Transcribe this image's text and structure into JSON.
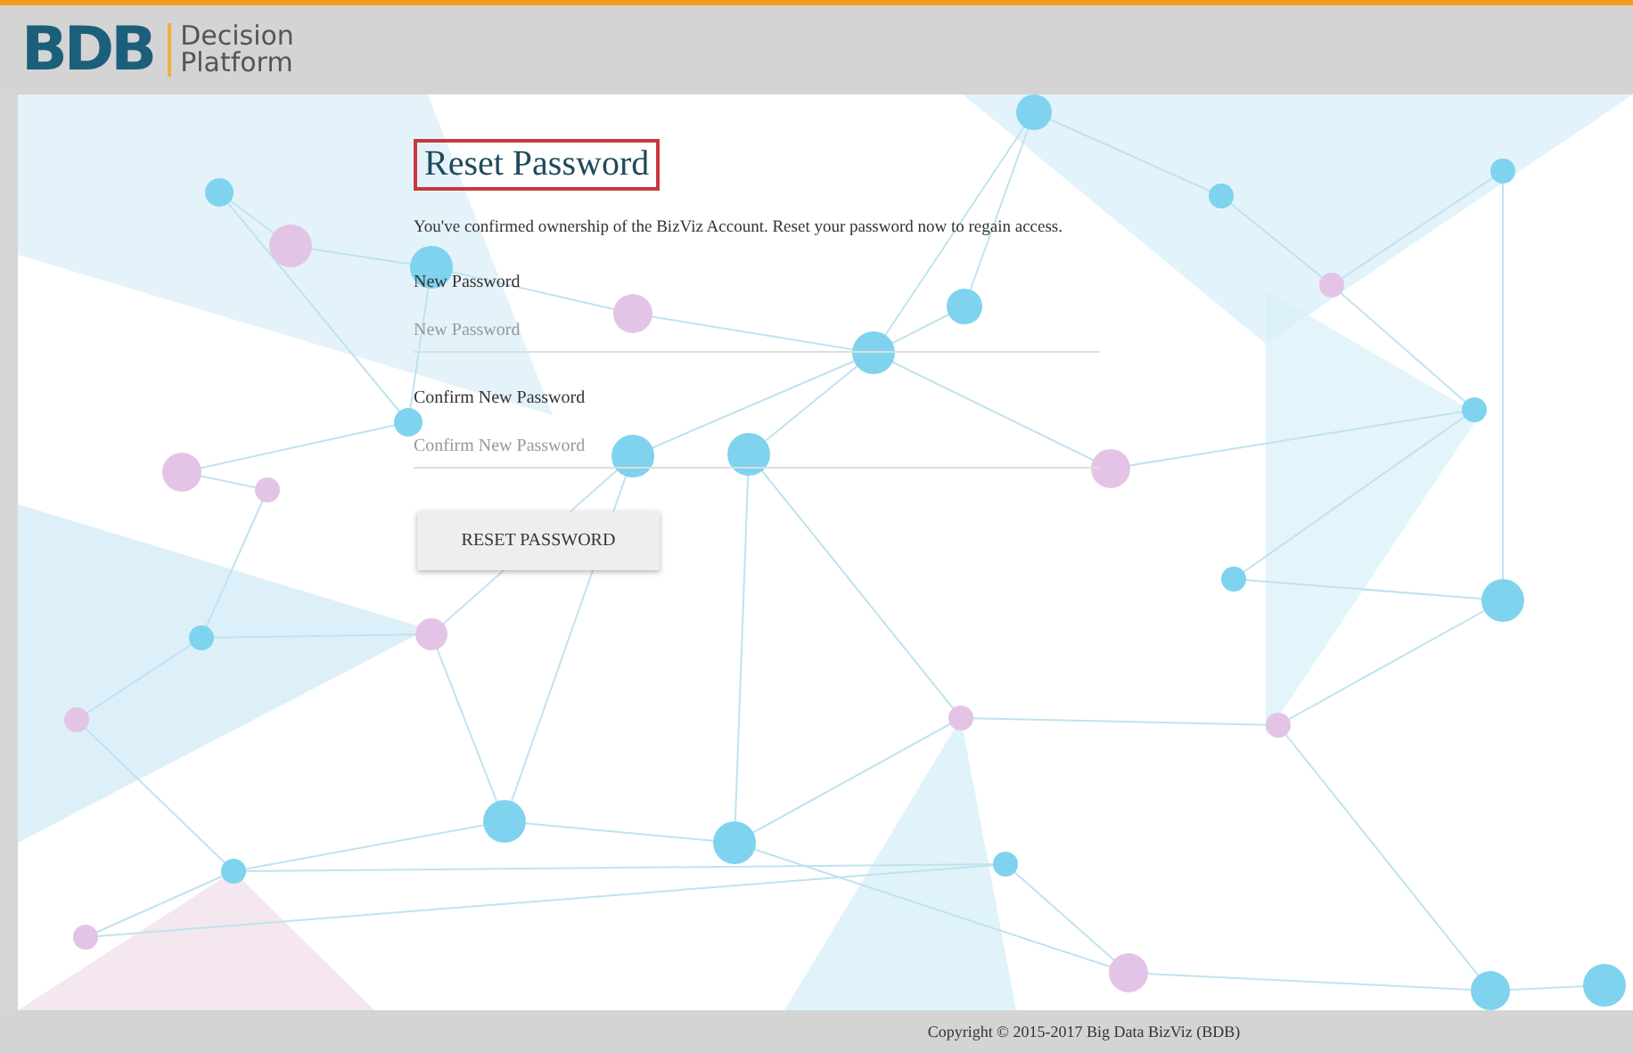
{
  "header": {
    "logo_mark": "BDB",
    "logo_text": [
      "Decision",
      "Platform"
    ]
  },
  "form": {
    "title": "Reset Password",
    "message": "You've confirmed ownership of the BizViz Account. Reset your password now to regain access.",
    "fields": [
      {
        "label": "New Password",
        "placeholder": "New Password"
      },
      {
        "label": "Confirm New Password",
        "placeholder": "Confirm New Password"
      }
    ],
    "button": "RESET PASSWORD"
  },
  "footer": {
    "copyright": "Copyright © 2015-2017 Big Data BizViz (BDB)"
  }
}
